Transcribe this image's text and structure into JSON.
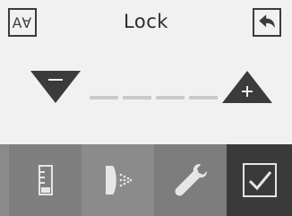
{
  "header": {
    "title": "Lock",
    "font_button_glyph": "A∀",
    "back_icon": "back-arrow-icon"
  },
  "controls": {
    "decrease_icon": "triangle-down-minus-icon",
    "increase_icon": "triangle-up-plus-icon",
    "value_placeholder": "____",
    "digit_count": 4
  },
  "toolbar": {
    "items": [
      {
        "icon": "level-gauge-icon"
      },
      {
        "icon": "spray-nozzle-icon"
      },
      {
        "icon": "wrench-icon"
      },
      {
        "icon": "checkbox-checked-icon",
        "active": true
      }
    ]
  },
  "colors": {
    "background": "#f1f1f1",
    "icon_dark": "#3b3b3b",
    "dash": "#c9c9c9",
    "toolbar_active": "#3a3a3a",
    "toolbar_inactive": "#808080"
  }
}
